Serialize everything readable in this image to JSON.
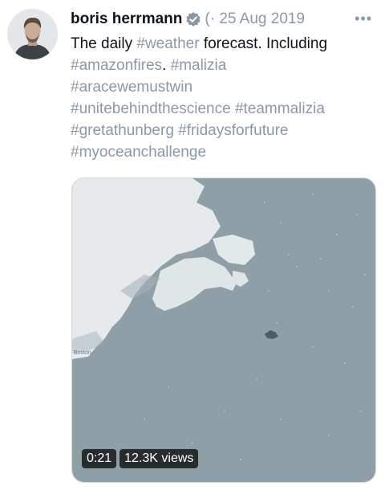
{
  "tweet": {
    "author_name": "boris herrmann",
    "partial_meta": "(·",
    "separator": "·",
    "date": "25 Aug 2019",
    "more_glyph": "•••",
    "text_parts": [
      {
        "type": "plain",
        "text": "The daily "
      },
      {
        "type": "hashtag",
        "text": "#weather"
      },
      {
        "type": "plain",
        "text": " forecast. Including "
      },
      {
        "type": "hashtag",
        "text": "#amazonfires"
      },
      {
        "type": "plain",
        "text": ". "
      },
      {
        "type": "hashtag",
        "text": "#malizia"
      },
      {
        "type": "hashtag",
        "text": "#aracewemustwin"
      },
      {
        "type": "hashtag",
        "text": "#unitebehindthescience"
      },
      {
        "type": "hashtag",
        "text": "#teammalizia"
      },
      {
        "type": "hashtag",
        "text": "#gretathunberg"
      },
      {
        "type": "hashtag",
        "text": "#fridaysforfuture"
      },
      {
        "type": "hashtag",
        "text": "#myoceanchallenge"
      }
    ]
  },
  "video": {
    "duration": "0:21",
    "views": "12.3K views",
    "map_label": "Boston"
  },
  "colors": {
    "hashtag": "#8b98a5",
    "verified": "#1d9bf0",
    "ocean": "#8e9fa8",
    "land": "#e6eaec"
  }
}
